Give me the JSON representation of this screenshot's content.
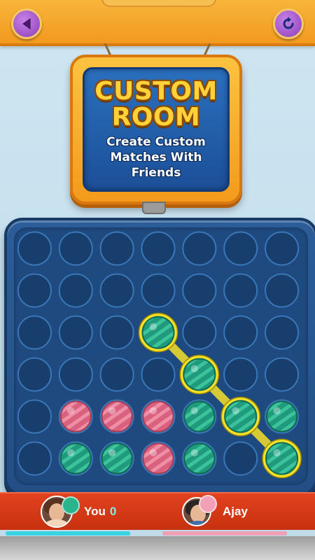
{
  "header": {
    "back_icon": "back-arrow-icon",
    "refresh_icon": "refresh-icon"
  },
  "sign": {
    "title_line1": "CUSTOM",
    "title_line2": "ROOM",
    "subtitle_line1": "Create Custom",
    "subtitle_line2": "Matches With Friends"
  },
  "board": {
    "columns": 7,
    "rows": 6,
    "cells": [
      [
        "empty",
        "empty",
        "empty",
        "empty",
        "empty",
        "empty",
        "empty"
      ],
      [
        "empty",
        "empty",
        "empty",
        "empty",
        "empty",
        "empty",
        "empty"
      ],
      [
        "empty",
        "empty",
        "empty",
        "green",
        "empty",
        "empty",
        "empty"
      ],
      [
        "empty",
        "empty",
        "empty",
        "empty",
        "green",
        "empty",
        "empty"
      ],
      [
        "empty",
        "pink",
        "pink",
        "pink",
        "green",
        "green",
        "green"
      ],
      [
        "empty",
        "green",
        "green",
        "pink",
        "green",
        "empty",
        "green"
      ]
    ],
    "winning_cells": [
      [
        2,
        3
      ],
      [
        3,
        4
      ],
      [
        4,
        5
      ],
      [
        5,
        6
      ]
    ],
    "colors": {
      "green": "#1f9a7c",
      "pink": "#d9607e",
      "highlight": "#f5e12a",
      "hole": "#173e6c"
    }
  },
  "players": {
    "you": {
      "name": "You",
      "score": "0",
      "token_color": "#2ab48e",
      "progress": 1.0
    },
    "opponent": {
      "name": "Ajay",
      "token_color": "#f2a0b5",
      "progress": 1.0
    }
  }
}
